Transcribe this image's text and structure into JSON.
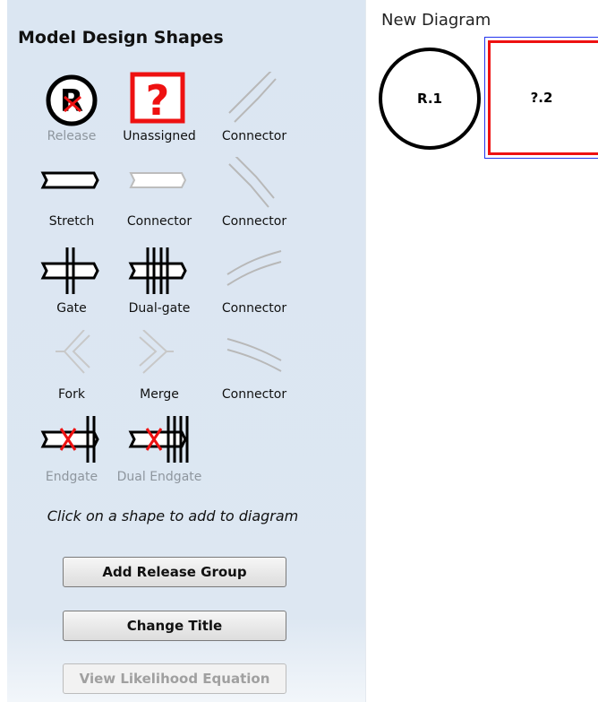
{
  "palette": {
    "title": "Model Design Shapes",
    "shapes": [
      {
        "label": "Release",
        "icon": "release-icon",
        "enabled": false
      },
      {
        "label": "Unassigned",
        "icon": "question-mark-icon",
        "enabled": true
      },
      {
        "label": "Connector",
        "icon": "connector-diagonal-up-icon",
        "enabled": true
      },
      {
        "label": "Stretch",
        "icon": "stretch-icon",
        "enabled": true
      },
      {
        "label": "Connector",
        "icon": "connector-straight-icon",
        "enabled": true
      },
      {
        "label": "Connector",
        "icon": "connector-diagonal-down-icon",
        "enabled": true
      },
      {
        "label": "Gate",
        "icon": "gate-icon",
        "enabled": true
      },
      {
        "label": "Dual-gate",
        "icon": "dual-gate-icon",
        "enabled": true
      },
      {
        "label": "Connector",
        "icon": "connector-curve-up-icon",
        "enabled": true
      },
      {
        "label": "Fork",
        "icon": "fork-icon",
        "enabled": true
      },
      {
        "label": "Merge",
        "icon": "merge-icon",
        "enabled": true
      },
      {
        "label": "Connector",
        "icon": "connector-curve-down-icon",
        "enabled": true
      },
      {
        "label": "Endgate",
        "icon": "endgate-icon",
        "enabled": false
      },
      {
        "label": "Dual Endgate",
        "icon": "dual-endgate-icon",
        "enabled": false
      }
    ],
    "hint": "Click on a shape to add to diagram",
    "buttons": {
      "add_release_group": "Add Release Group",
      "change_title": "Change Title",
      "view_likelihood_equation": "View Likelihood Equation"
    }
  },
  "diagram": {
    "title": "New Diagram",
    "nodes": [
      {
        "label": "R.1",
        "shape": "circle"
      },
      {
        "label": "?.2",
        "shape": "unassigned-box"
      }
    ]
  },
  "colors": {
    "panel_background": "#dbe6f2",
    "accent_red": "#ee1111",
    "selection_blue": "#2233ee",
    "disabled_text": "#8e969e",
    "connector_gray": "#b8b8b8"
  }
}
